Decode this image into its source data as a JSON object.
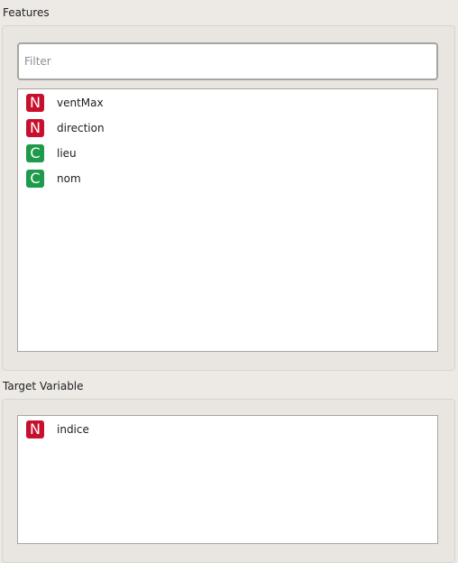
{
  "features": {
    "title": "Features",
    "filter_placeholder": "Filter",
    "filter_value": "",
    "items": [
      {
        "type": "N",
        "label": "ventMax",
        "color": "#c8102e"
      },
      {
        "type": "N",
        "label": "direction",
        "color": "#c8102e"
      },
      {
        "type": "C",
        "label": "lieu",
        "color": "#1e9a4b"
      },
      {
        "type": "C",
        "label": "nom",
        "color": "#1e9a4b"
      }
    ]
  },
  "target": {
    "title": "Target Variable",
    "items": [
      {
        "type": "N",
        "label": "indice",
        "color": "#c8102e"
      }
    ]
  },
  "colors": {
    "numeric_badge": "#c8102e",
    "categorical_badge": "#1e9a4b",
    "panel_background": "#edeae5"
  }
}
